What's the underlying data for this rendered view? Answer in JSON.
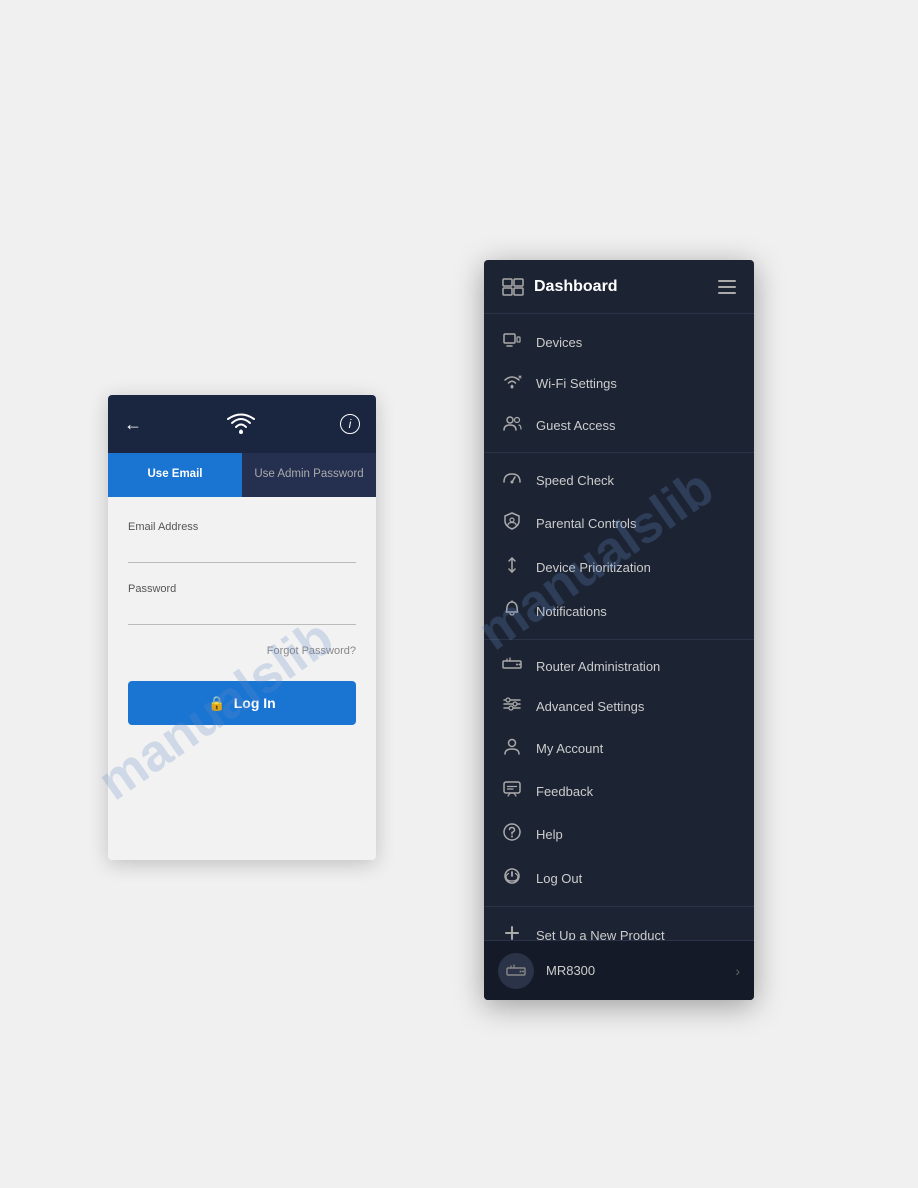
{
  "page": {
    "background": "#f0f0f0"
  },
  "login": {
    "back_label": "←",
    "info_label": "i",
    "wifi_icon": "WiFi",
    "tab_email": "Use Email",
    "tab_admin": "Use Admin Password",
    "email_label": "Email Address",
    "email_placeholder": "",
    "password_label": "Password",
    "password_placeholder": "",
    "forgot_password": "Forgot Password?",
    "login_button": "Log In",
    "lock_icon": "🔒"
  },
  "nav": {
    "title": "Dashboard",
    "hamburger_label": "Menu",
    "items": [
      {
        "id": "devices",
        "label": "Devices",
        "icon": "monitor"
      },
      {
        "id": "wifi-settings",
        "label": "Wi-Fi Settings",
        "icon": "wifi"
      },
      {
        "id": "guest-access",
        "label": "Guest Access",
        "icon": "users"
      },
      {
        "id": "speed-check",
        "label": "Speed Check",
        "icon": "speedometer"
      },
      {
        "id": "parental-controls",
        "label": "Parental Controls",
        "icon": "shield"
      },
      {
        "id": "device-prioritization",
        "label": "Device Prioritization",
        "icon": "priority"
      },
      {
        "id": "notifications",
        "label": "Notifications",
        "icon": "bell"
      },
      {
        "id": "router-admin",
        "label": "Router Administration",
        "icon": "router"
      },
      {
        "id": "advanced-settings",
        "label": "Advanced Settings",
        "icon": "sliders"
      },
      {
        "id": "my-account",
        "label": "My Account",
        "icon": "user"
      },
      {
        "id": "feedback",
        "label": "Feedback",
        "icon": "chat"
      },
      {
        "id": "help",
        "label": "Help",
        "icon": "question"
      },
      {
        "id": "log-out",
        "label": "Log Out",
        "icon": "power"
      },
      {
        "id": "setup-new",
        "label": "Set Up a New Product",
        "icon": "plus"
      }
    ],
    "router": {
      "name": "MR8300",
      "icon": "router"
    }
  }
}
